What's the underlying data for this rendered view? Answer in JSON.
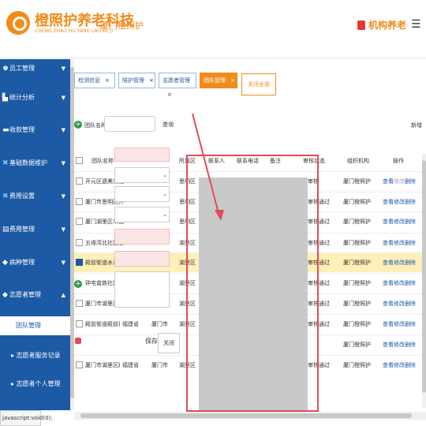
{
  "header": {
    "brand_cn": "橙照护养老科技",
    "brand_en": "CHENG ZHAO HU YANG LAO KE JI",
    "link": "厦门橙照护",
    "org": "机构养老",
    "menu": "☰"
  },
  "sidebar": {
    "items": [
      {
        "label": "员工管理",
        "icon": "users-icon",
        "glyph": "♚",
        "arrow": "▼"
      },
      {
        "label": "统计分析",
        "icon": "chart-icon",
        "glyph": "▙",
        "arrow": "▼"
      },
      {
        "label": "收款管理",
        "icon": "money-icon",
        "glyph": "▬",
        "arrow": "▼"
      },
      {
        "label": "基础数据维护",
        "icon": "wrench-icon",
        "glyph": "✖",
        "arrow": "▼"
      },
      {
        "label": "费用设置",
        "icon": "wrench-icon",
        "glyph": "✖",
        "arrow": "▼"
      },
      {
        "label": "费用管理",
        "icon": "doc-icon",
        "glyph": "▤",
        "arrow": "▼"
      },
      {
        "label": "病种管理",
        "icon": "tag-icon",
        "glyph": "◆",
        "arrow": "▼"
      },
      {
        "label": "志愿者管理",
        "icon": "tag-icon",
        "glyph": "◆",
        "arrow": "▲"
      }
    ],
    "sub": [
      {
        "label": "团队管理"
      },
      {
        "label": "志愿者服务记录"
      },
      {
        "label": "志愿者个人管理"
      }
    ]
  },
  "status_bar": "javascript:void(0);",
  "tabs": [
    {
      "label": "检测信息"
    },
    {
      "label": "陪护管理"
    },
    {
      "label": "志愿者管理"
    },
    {
      "label": "团队管理"
    }
  ],
  "tab_close": "×",
  "close_all": "关闭全部",
  "search": {
    "label": "团队名称",
    "button": "查询",
    "add": "新增"
  },
  "table": {
    "headers": [
      "团队名称",
      "所属区",
      "联系人",
      "联系电话",
      "备注",
      "审核状态",
      "组织机构",
      "操作"
    ],
    "rows": [
      {
        "name": "开元区遗美湖社区",
        "district": "思明区",
        "status": "审核",
        "org": "厦门橙照护",
        "ops": [
          "查看",
          "修改",
          "删除"
        ]
      },
      {
        "name": "厦门市思明区开元",
        "district": "思明区",
        "status": "审核通过",
        "org": "厦门橙照护",
        "ops": [
          "查看",
          "修改",
          "删除"
        ]
      },
      {
        "name": "厦门湖里区禾山",
        "district": "思明区",
        "status": "审核通过",
        "org": "厦门橙照护",
        "ops": [
          "查看",
          "修改",
          "删除"
        ]
      },
      {
        "name": "五缘湾北社区志",
        "district": "湖里区",
        "status": "审核通过",
        "org": "厦门橙照护",
        "ops": [
          "查看",
          "修改",
          "删除"
        ]
      },
      {
        "name": "殿前街道水长社区",
        "district": "湖里区",
        "status": "审核通过",
        "org": "厦门橙照护",
        "ops": [
          "查看",
          "修改",
          "删除"
        ],
        "selected": true
      },
      {
        "name": "钟宅畲族社区",
        "district": "湖里区",
        "status": "审核通过",
        "org": "厦门橙照护",
        "ops": [
          "查看",
          "修改",
          "删除"
        ]
      },
      {
        "name": "厦门市湖里区殿",
        "district": "湖里区",
        "status": "审核通过",
        "org": "厦门橙照护",
        "ops": [
          "查看",
          "修改",
          "删除"
        ]
      },
      {
        "name": "殿前街道殿前社",
        "district": "湖里区",
        "status": "审核通过",
        "org": "厦门橙照护",
        "ops": [
          "查看",
          "修改",
          "删除"
        ],
        "extra": [
          "福建省",
          "厦门市"
        ]
      },
      {
        "name": "",
        "district": "",
        "status": "",
        "org": "厦门橙照护",
        "ops": [
          "查看",
          "修改",
          "删除"
        ]
      },
      {
        "name": "厦门市湖里区殿",
        "district": "湖里区",
        "status": "审核通过",
        "org": "厦门橙照护",
        "ops": [
          "查看",
          "修改",
          "删除"
        ],
        "extra": [
          "福建省",
          "厦门市"
        ]
      }
    ]
  },
  "popup": {
    "save": "保存",
    "close": "关闭"
  }
}
